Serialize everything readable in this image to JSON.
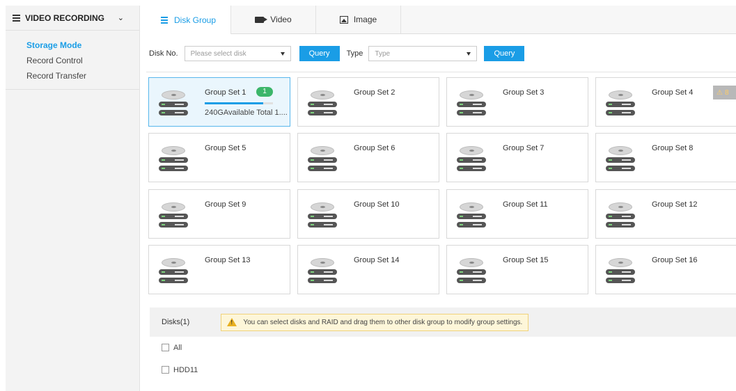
{
  "sidebar": {
    "title": "VIDEO RECORDING",
    "items": [
      {
        "label": "Storage Mode",
        "active": true
      },
      {
        "label": "Record Control",
        "active": false
      },
      {
        "label": "Record Transfer",
        "active": false
      }
    ]
  },
  "tabs": [
    {
      "label": "Disk Group",
      "icon": "list-icon",
      "active": true
    },
    {
      "label": "Video",
      "icon": "video-camera-icon",
      "active": false
    },
    {
      "label": "Image",
      "icon": "image-icon",
      "active": false
    }
  ],
  "query": {
    "disk_label": "Disk No.",
    "disk_placeholder": "Please select disk",
    "query_label": "Query",
    "type_label": "Type",
    "type_placeholder": "Type",
    "query2_label": "Query"
  },
  "groups": [
    {
      "name": "Group Set 1",
      "badge": "1",
      "capacity": "240GAvailable Total 1....",
      "progress": 0.86,
      "selected": true
    },
    {
      "name": "Group Set 2"
    },
    {
      "name": "Group Set 3"
    },
    {
      "name": "Group Set 4",
      "warning": "8"
    },
    {
      "name": "Group Set 5"
    },
    {
      "name": "Group Set 6"
    },
    {
      "name": "Group Set 7"
    },
    {
      "name": "Group Set 8"
    },
    {
      "name": "Group Set 9"
    },
    {
      "name": "Group Set 10"
    },
    {
      "name": "Group Set 11"
    },
    {
      "name": "Group Set 12"
    },
    {
      "name": "Group Set 13"
    },
    {
      "name": "Group Set 14"
    },
    {
      "name": "Group Set 15"
    },
    {
      "name": "Group Set 16"
    }
  ],
  "disks": {
    "title": "Disks(1)",
    "tip": "You can select disks and RAID and drag them to other disk group to modify group settings.",
    "all_label": "All",
    "items": [
      "HDD11"
    ]
  },
  "colors": {
    "accent": "#1a9de6",
    "badge_green": "#3cb66a",
    "tip_bg": "#fdf6d9"
  }
}
